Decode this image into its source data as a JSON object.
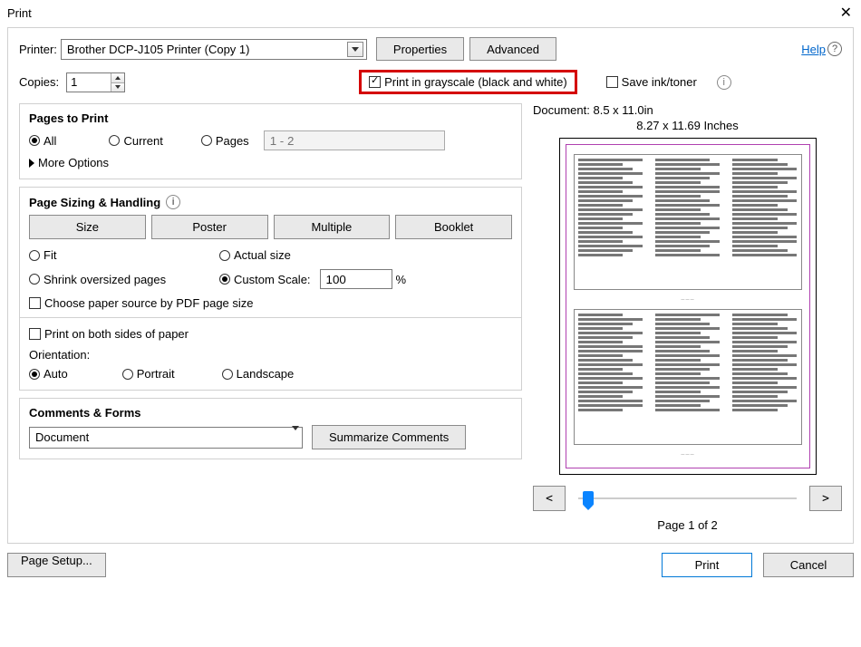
{
  "title": "Print",
  "close_glyph": "✕",
  "help_label": "Help",
  "help_glyph": "?",
  "printer": {
    "label": "Printer:",
    "selected": "Brother DCP-J105 Printer (Copy 1)",
    "properties_btn": "Properties",
    "advanced_btn": "Advanced"
  },
  "copies": {
    "label": "Copies:",
    "value": "1"
  },
  "grayscale": {
    "label": "Print in grayscale (black and white)",
    "checked": true
  },
  "saveink": {
    "label": "Save ink/toner",
    "checked": false,
    "info_glyph": "i"
  },
  "pages_panel": {
    "title": "Pages to Print",
    "all": "All",
    "current": "Current",
    "pages": "Pages",
    "pages_range_placeholder": "1 - 2",
    "selected": "all",
    "more_options": "More Options"
  },
  "sizing_panel": {
    "title": "Page Sizing & Handling",
    "info_glyph": "i",
    "modes": [
      "Size",
      "Poster",
      "Multiple",
      "Booklet"
    ],
    "fit": "Fit",
    "actual": "Actual size",
    "shrink": "Shrink oversized pages",
    "custom": "Custom Scale:",
    "scale_value": "100",
    "scale_unit": "%",
    "selected_scale": "custom",
    "choose_paper_source": "Choose paper source by PDF page size",
    "choose_paper_checked": false,
    "duplex": "Print on both sides of paper",
    "duplex_checked": false,
    "orientation_label": "Orientation:",
    "orientation_opts": {
      "auto": "Auto",
      "portrait": "Portrait",
      "landscape": "Landscape"
    },
    "orientation_selected": "auto"
  },
  "comments_panel": {
    "title": "Comments & Forms",
    "selected": "Document",
    "summarize_btn": "Summarize Comments"
  },
  "preview": {
    "doc_dims": "Document: 8.5 x 11.0in",
    "paper_dims": "8.27 x 11.69 Inches",
    "prev_glyph": "<",
    "next_glyph": ">",
    "page_counter": "Page 1 of 2"
  },
  "footer": {
    "page_setup": "Page Setup...",
    "print": "Print",
    "cancel": "Cancel"
  }
}
